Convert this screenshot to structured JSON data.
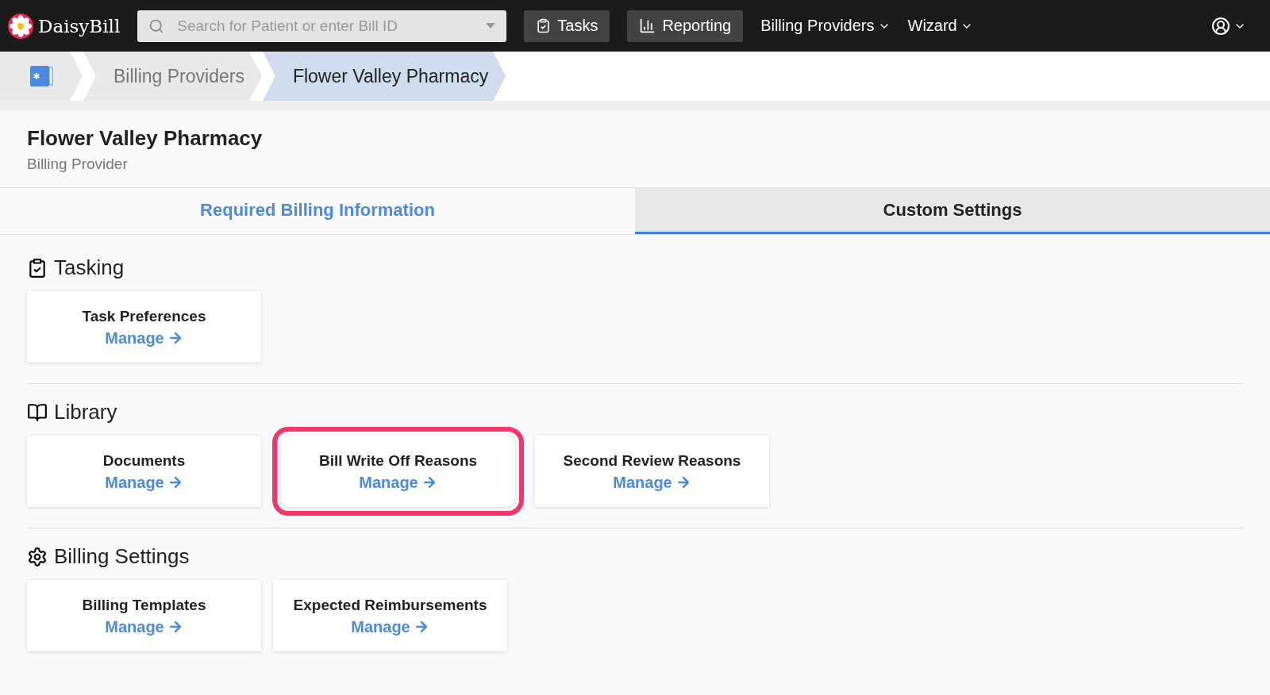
{
  "navbar": {
    "brand": "DaisyBill",
    "search": {
      "placeholder": "Search for Patient or enter Bill ID"
    },
    "buttons": [
      {
        "label": "Tasks",
        "kind": "tasks"
      },
      {
        "label": "Reporting",
        "kind": "reporting"
      }
    ],
    "menus": [
      "Billing Providers",
      "Wizard"
    ]
  },
  "breadcrumb": [
    {
      "label": "Billing Providers",
      "selected": false
    },
    {
      "label": "Flower Valley Pharmacy",
      "selected": true
    }
  ],
  "header": {
    "title": "Flower Valley Pharmacy",
    "subtitle": "Billing Provider"
  },
  "tabs": [
    {
      "label": "Required Billing Information",
      "selected": false
    },
    {
      "label": "Custom Settings",
      "selected": true
    }
  ],
  "sections": [
    {
      "title": "Tasking",
      "kind": "tasking",
      "cards": [
        {
          "title": "Task Preferences",
          "link": "Manage",
          "highlighted": false
        }
      ]
    },
    {
      "title": "Library",
      "kind": "library",
      "cards": [
        {
          "title": "Documents",
          "link": "Manage",
          "highlighted": false
        },
        {
          "title": "Bill Write Off Reasons",
          "link": "Manage",
          "highlighted": true
        },
        {
          "title": "Second Review Reasons",
          "link": "Manage",
          "highlighted": false
        }
      ]
    },
    {
      "title": "Billing Settings",
      "kind": "billing",
      "cards": [
        {
          "title": "Billing Templates",
          "link": "Manage",
          "highlighted": false
        },
        {
          "title": "Expected Reimbursements",
          "link": "Manage",
          "highlighted": false
        }
      ]
    }
  ]
}
